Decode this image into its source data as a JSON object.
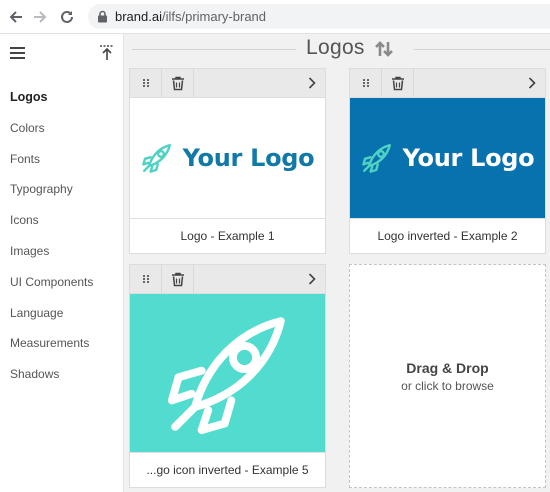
{
  "browser": {
    "url_host": "brand.ai",
    "url_path": "/ilfs/primary-brand"
  },
  "sidebar": {
    "items": [
      {
        "label": "Logos",
        "active": true
      },
      {
        "label": "Colors"
      },
      {
        "label": "Fonts"
      },
      {
        "label": "Typography"
      },
      {
        "label": "Icons"
      },
      {
        "label": "Images"
      },
      {
        "label": "UI Components"
      },
      {
        "label": "Language"
      },
      {
        "label": "Measurements"
      },
      {
        "label": "Shadows"
      }
    ]
  },
  "header": {
    "title": "Logos",
    "sort_icon": "sort-arrows-icon"
  },
  "cards": [
    {
      "caption": "Logo - Example 1",
      "logo_text": "Your Logo",
      "background": "#ffffff",
      "logo_color": "#1179a8",
      "icon_color": "#4fd1c5"
    },
    {
      "caption": "Logo inverted - Example 2",
      "logo_text": "Your Logo",
      "background": "#0872ae",
      "logo_color": "#ffffff",
      "icon_color": "#4fd1c5"
    },
    {
      "caption": "...go icon inverted - Example 5",
      "background": "#52dccf",
      "icon_color": "#ffffff"
    }
  ],
  "dropzone": {
    "title": "Drag & Drop",
    "subtitle": "or click to browse"
  },
  "icons": {
    "back": "arrow-left-icon",
    "forward": "arrow-right-icon",
    "reload": "reload-icon",
    "lock": "lock-icon",
    "menu": "hamburger-icon",
    "collapse": "collapse-up-icon",
    "drag": "drag-dots-icon",
    "delete": "trash-icon",
    "open": "chevron-right-icon",
    "logo_mark": "rocket-icon"
  }
}
